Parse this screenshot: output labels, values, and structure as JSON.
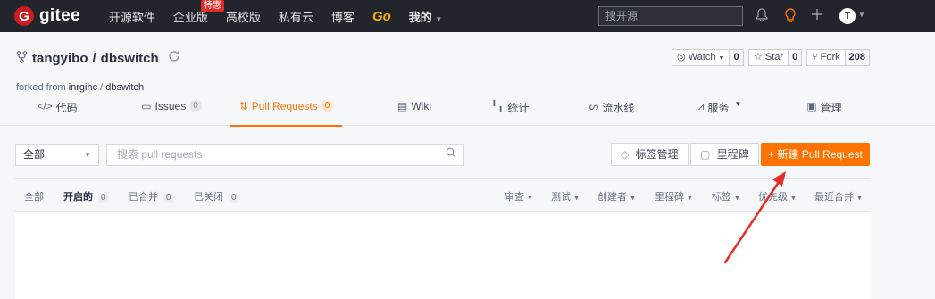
{
  "topnav": {
    "logo_mark": "G",
    "logo_text": "gitee",
    "items": [
      {
        "label": "开源软件"
      },
      {
        "label": "企业版",
        "badge": "特惠"
      },
      {
        "label": "高校版"
      },
      {
        "label": "私有云"
      },
      {
        "label": "博客"
      },
      {
        "label": "Go"
      },
      {
        "label": "我的"
      }
    ],
    "search_placeholder": "搜开源",
    "avatar_letter": "T"
  },
  "repo": {
    "owner": "tangyibo",
    "separator": "/",
    "name": "dbswitch",
    "forked_prefix": "forked from ",
    "forked_owner": "inrgihc",
    "forked_sep": " / ",
    "forked_repo": "dbswitch",
    "watch": {
      "label": "Watch",
      "count": "0"
    },
    "star": {
      "label": "Star",
      "count": "0"
    },
    "fork": {
      "label": "Fork",
      "count": "208"
    }
  },
  "tabs": [
    {
      "label": "代码"
    },
    {
      "label": "Issues",
      "count": "0"
    },
    {
      "label": "Pull Requests",
      "count": "0"
    },
    {
      "label": "Wiki"
    },
    {
      "label": "统计"
    },
    {
      "label": "流水线"
    },
    {
      "label": "服务"
    },
    {
      "label": "管理"
    }
  ],
  "filter": {
    "select_value": "全部",
    "search_placeholder": "搜索 pull requests",
    "labels_button": "标签管理",
    "milestone_button": "里程碑",
    "new_pr_button": "+ 新建 Pull Request"
  },
  "status": {
    "all": "全部",
    "open": "开启的",
    "open_count": "0",
    "merged": "已合并",
    "merged_count": "0",
    "closed": "已关闭",
    "closed_count": "0",
    "filters": [
      "审查",
      "测试",
      "创建者",
      "里程碑",
      "标签",
      "优先级",
      "最近合并"
    ]
  },
  "colors": {
    "accent": "#fe7300",
    "nav_bg": "#22252b",
    "arrow": "#e52d27"
  }
}
